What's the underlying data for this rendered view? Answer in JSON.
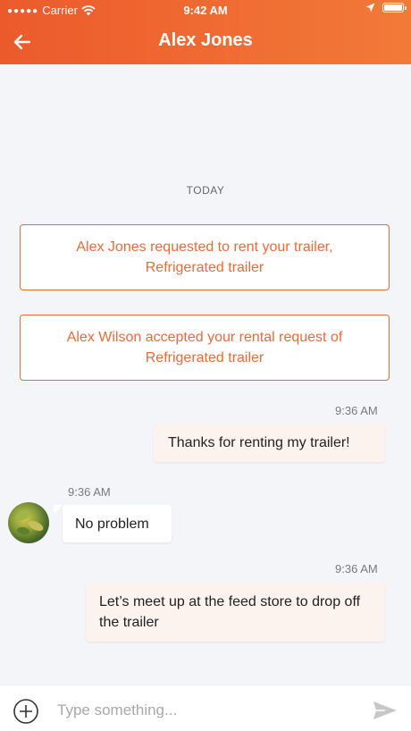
{
  "status_bar": {
    "carrier": "Carrier",
    "time": "9:42 AM",
    "icons": [
      "signal-dots-icon",
      "wifi-icon",
      "location-arrow-icon",
      "battery-icon"
    ]
  },
  "header": {
    "title": "Alex Jones",
    "back_icon": "back-arrow-icon",
    "gradient": [
      "#ec5a2c",
      "#f27a38"
    ]
  },
  "chat": {
    "date_divider": "TODAY",
    "system_messages": [
      "Alex Jones requested to rent your trailer, Refrigerated trailer",
      "Alex Wilson accepted your rental request of Refrigerated trailer"
    ],
    "messages": [
      {
        "direction": "outgoing",
        "time": "9:36 AM",
        "text": "Thanks for renting my trailer!"
      },
      {
        "direction": "incoming",
        "time": "9:36 AM",
        "text": "No problem",
        "avatar": "contact-avatar"
      },
      {
        "direction": "outgoing",
        "time": "9:36 AM",
        "text": "Let’s meet up at the feed store to drop off the trailer"
      }
    ]
  },
  "composer": {
    "placeholder": "Type something...",
    "value": "",
    "add_icon": "plus-circle-icon",
    "send_icon": "send-icon"
  },
  "colors": {
    "accent": "#ec6a36",
    "outgoing_bubble": "#fdf3ee",
    "incoming_bubble": "#ffffff",
    "background": "#f4f5f9"
  }
}
